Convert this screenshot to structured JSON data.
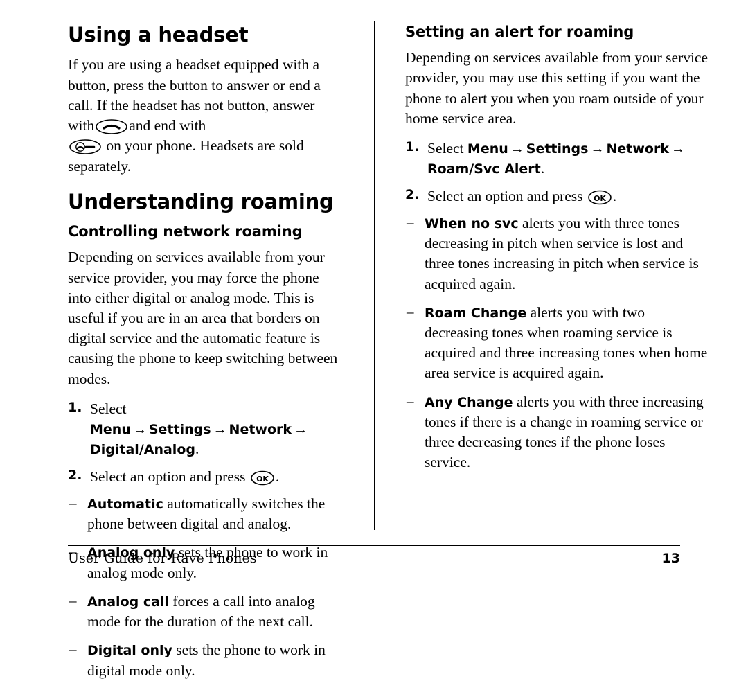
{
  "document": {
    "footer": {
      "left": "User Guide for Rave Phones",
      "page_number": "13"
    }
  },
  "left_column": {
    "heading_1": "Using a headset",
    "paragraph_1_a": "If you are using a headset equipped with a button, press the button to answer or end a call. If the headset has not button, answer with",
    "paragraph_1_b": "and end with",
    "paragraph_1_c": "on your phone. Headsets are sold separately.",
    "heading_2": "Understanding roaming",
    "heading_3": "Controlling network roaming",
    "paragraph_2": "Depending on services available from your service provider, you may force the phone into either digital or analog mode. This is useful if you are in an area that borders on digital service and the automatic feature is causing the phone to keep switching between modes.",
    "steps": [
      {
        "num": "1.",
        "lead": "Select",
        "path": [
          "Menu",
          "Settings",
          "Network",
          "Digital/Analog"
        ],
        "tail": "."
      },
      {
        "num": "2.",
        "text_before": "Select an option and press",
        "text_after": "."
      }
    ],
    "options": [
      {
        "term": "Automatic",
        "desc": "automatically switches the phone between digital and analog."
      },
      {
        "term": "Analog only",
        "desc": "sets the phone to work in analog mode only."
      },
      {
        "term": "Analog call",
        "desc": "forces a call into analog mode for the duration of the next call."
      },
      {
        "term": "Digital only",
        "desc": "sets the phone to work in digital mode only."
      }
    ]
  },
  "right_column": {
    "heading_1": "Setting an alert for roaming",
    "paragraph_1": "Depending on services available from your service provider, you may use this setting if you want the phone to alert you when you roam outside of your home service area.",
    "steps": [
      {
        "num": "1.",
        "lead": "Select",
        "path": [
          "Menu",
          "Settings",
          "Network",
          "Roam/Svc Alert"
        ],
        "tail": "."
      },
      {
        "num": "2.",
        "text_before": "Select an option and press",
        "text_after": "."
      }
    ],
    "options": [
      {
        "term": "When no svc",
        "desc": "alerts you with three tones decreasing in pitch when service is lost and three tones increasing in pitch when service is acquired again."
      },
      {
        "term": "Roam Change",
        "desc": "alerts you with two decreasing tones when roaming service is acquired and three increasing tones when home area service is acquired again."
      },
      {
        "term": "Any Change",
        "desc": "alerts you with three increasing tones if there is a change in roaming service or three decreasing tones if the phone loses service."
      }
    ]
  },
  "icons": {
    "send_key": "send-key-icon",
    "end_key": "end-key-icon",
    "ok_key": "ok-key-icon",
    "arrow": "→",
    "dash": "–"
  }
}
